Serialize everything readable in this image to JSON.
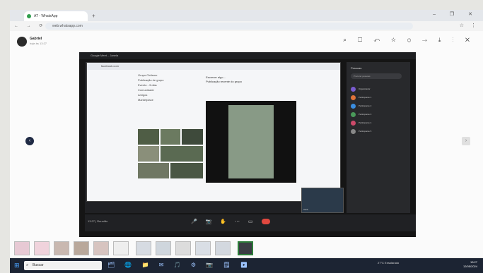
{
  "browser": {
    "tab_title": "AT - WhatsApp",
    "new_tab": "+",
    "window_controls": "– ❐ ✕",
    "url": "web.whatsapp.com",
    "nav": "← → ⟳",
    "extensions": "☆ ⋮"
  },
  "viewer": {
    "sender_name": "Gabriel",
    "sender_time": "hoje às 13:27",
    "tools": "⌕ ☐ ↶ ☆ ⊙ ⇢ ⤓ ⋮ ✕",
    "prev": "‹",
    "next": "›"
  },
  "photo": {
    "inner_title": "Google Meet – Janela",
    "shared_url": "facebook.com",
    "feed_lines": [
      "Grupo Ciclismo",
      "Publicação de grupo",
      "Evento - 3 dias",
      "Comunidade",
      "Amigos",
      "Marketplace"
    ],
    "post_lines": [
      "Escrever algo...",
      "Publicação recente do grupo"
    ],
    "pip_label": "Você",
    "meet_left": "13:27 | Reunião",
    "toolbar_buttons": "🎤 📷 ✋ ⋯ ▭",
    "participants_title": "Pessoas",
    "participants_search": "Procurar pessoas",
    "participants": [
      {
        "name": "Organizador",
        "color": "#7a5ccf"
      },
      {
        "name": "Participante 1",
        "color": "#e0733a"
      },
      {
        "name": "Participante 2",
        "color": "#3a8de0"
      },
      {
        "name": "Participante 3",
        "color": "#4a9a5a"
      },
      {
        "name": "Participante 4",
        "color": "#cc4a6a"
      },
      {
        "name": "Participante 5",
        "color": "#888888"
      }
    ]
  },
  "taskbar": {
    "search_placeholder": "Buscar",
    "apps": "🗂 🌐 📁 ✉ 🎵 ⚙ 📷 🗒 ▶",
    "weather": "27°C  Ensolarado",
    "time": "13:27",
    "date": "12/05/2024"
  }
}
